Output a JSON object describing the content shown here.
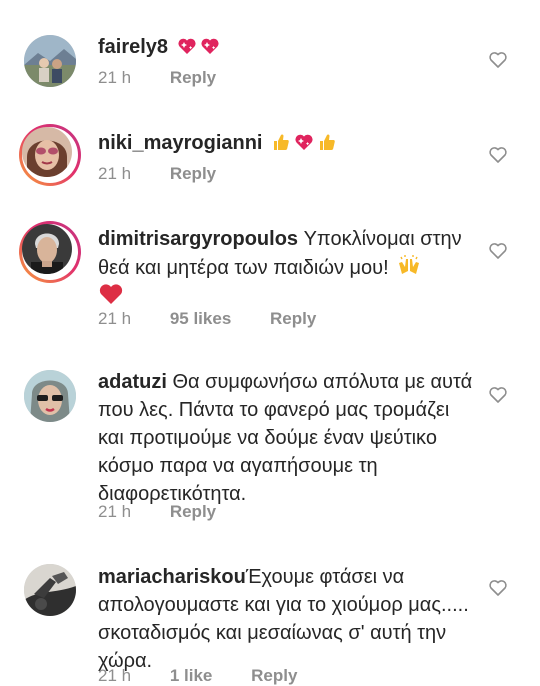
{
  "comments": [
    {
      "username": "fairely8",
      "text": "",
      "time": "21 h",
      "likes": "",
      "reply": "Reply",
      "emojis": [
        "sparkling-heart",
        "sparkling-heart"
      ]
    },
    {
      "username": "niki_mayrogianni",
      "text": "",
      "time": "21 h",
      "likes": "",
      "reply": "Reply",
      "emojis": [
        "thumbs-up",
        "sparkling-heart",
        "thumbs-up"
      ]
    },
    {
      "username": "dimitrisargyropoulos",
      "text": "Υποκλίνομαι στην θεά και μητέρα των παιδιών μου!",
      "time": "21 h",
      "likes": "95 likes",
      "reply": "Reply",
      "emojis": [
        "raised-hands",
        "red-heart"
      ]
    },
    {
      "username": "adatuzi",
      "text": "Θα συμφωνήσω απόλυτα με αυτά που λες. Πάντα το φανερό μας τρομάζει και προτιμούμε να δούμε έναν ψεύτικο κόσμο παρα να αγαπήσουμε τη διαφορετικότητα.",
      "time": "21 h",
      "likes": "",
      "reply": "Reply",
      "emojis": []
    },
    {
      "username": "mariachariskou",
      "text": "Έχουμε φτάσει να απολογουμαστε και για το χιούμορ μας..... σκοταδισμός και μεσαίωνας σ' αυτή την χώρα.",
      "time": "21 h",
      "likes": "1 like",
      "reply": "Reply",
      "emojis": []
    }
  ],
  "colors": {
    "text": "#262626",
    "meta": "#8e8e8e",
    "story_ring_start": "#f9a23b",
    "story_ring_end": "#c13584",
    "emoji_heart": "#e0245e",
    "emoji_thumb": "#f7b928"
  }
}
